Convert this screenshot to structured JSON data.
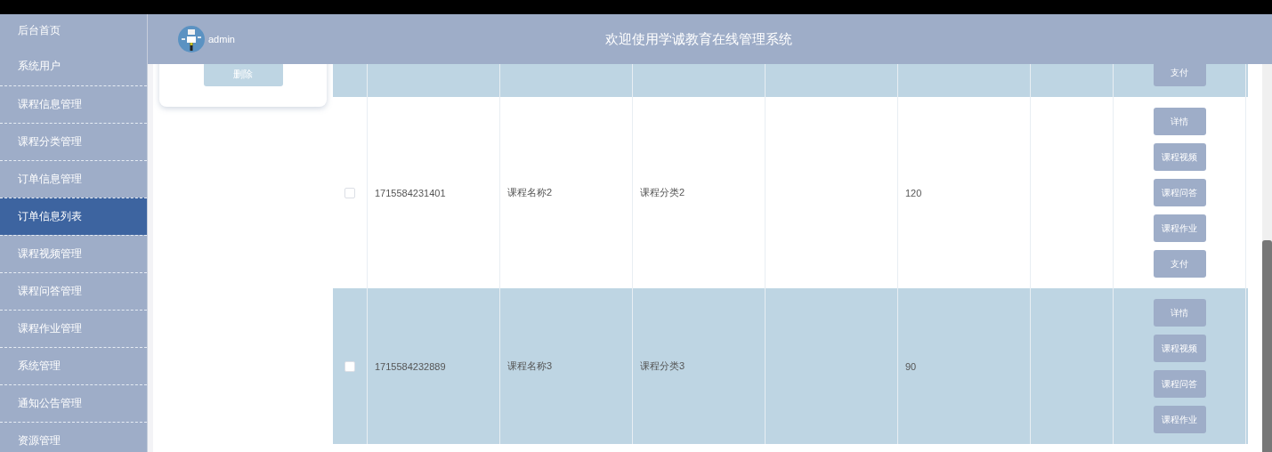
{
  "sidebar": {
    "items": [
      {
        "label": "后台首页",
        "selected": false
      },
      {
        "label": "系统用户",
        "selected": false
      },
      {
        "label": "课程信息管理",
        "selected": false
      },
      {
        "label": "课程分类管理",
        "selected": false
      },
      {
        "label": "订单信息管理",
        "selected": false
      },
      {
        "label": "订单信息列表",
        "selected": true
      },
      {
        "label": "课程视频管理",
        "selected": false
      },
      {
        "label": "课程问答管理",
        "selected": false
      },
      {
        "label": "课程作业管理",
        "selected": false
      },
      {
        "label": "系统管理",
        "selected": false
      },
      {
        "label": "通知公告管理",
        "selected": false
      },
      {
        "label": "资源管理",
        "selected": false
      }
    ]
  },
  "header": {
    "username": "admin",
    "title": "欢迎使用学诚教育在线管理系统"
  },
  "card": {
    "button": "删除"
  },
  "table": {
    "rows": [
      {
        "actions": [
          "支付"
        ]
      },
      {
        "checked": false,
        "column_2": "1715584231401",
        "column_3": "课程名称2",
        "column_4": "课程分类2",
        "column_6": "120",
        "actions": [
          "详情",
          "课程视频",
          "课程问答",
          "课程作业",
          "支付"
        ]
      },
      {
        "checked": false,
        "column_2": "1715584232889",
        "column_3": "课程名称3",
        "column_4": "课程分类3",
        "column_6": "90",
        "actions": [
          "详情",
          "课程视频",
          "课程问答",
          "课程作业"
        ]
      }
    ]
  }
}
